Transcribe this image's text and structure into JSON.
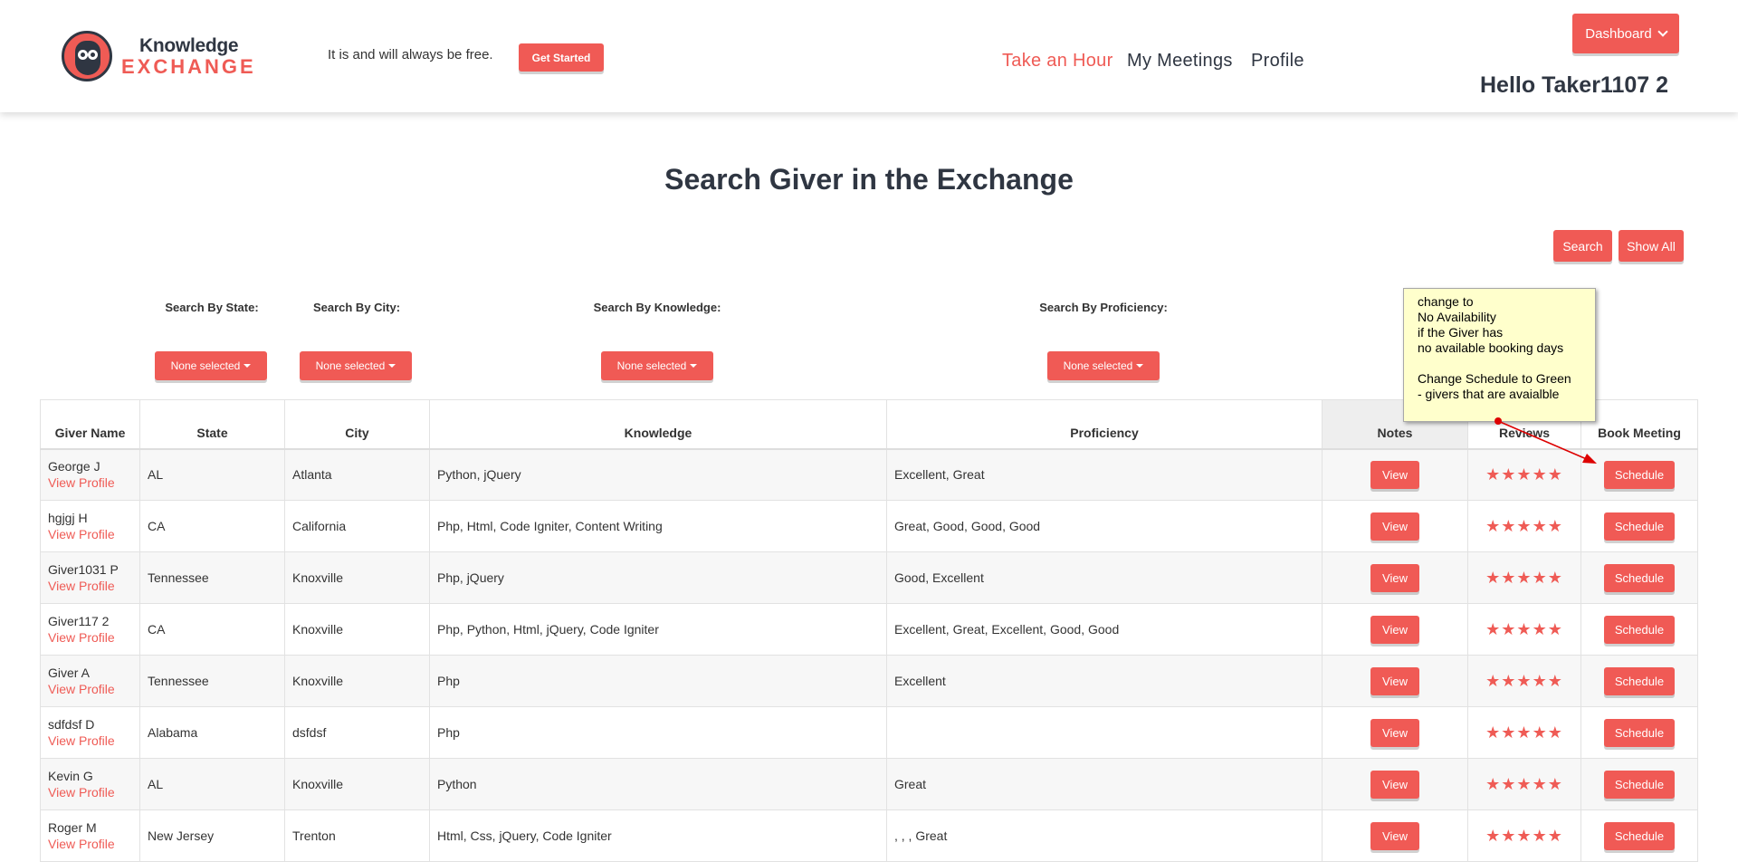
{
  "header": {
    "logo": {
      "line1": "Knowledge",
      "line2": "EXCHANGE"
    },
    "tagline": "It is and will always be free.",
    "get_started": "Get Started",
    "nav": [
      "Take an Hour",
      "My Meetings",
      "Profile"
    ],
    "dashboard": "Dashboard",
    "greeting": "Hello Taker1107 2"
  },
  "page_title": "Search Giver in the Exchange",
  "actions": {
    "search": "Search",
    "show_all": "Show All"
  },
  "filters": [
    {
      "label": "Search By State:",
      "value": "None selected"
    },
    {
      "label": "Search By City:",
      "value": "None selected"
    },
    {
      "label": "Search By Knowledge:",
      "value": "None selected"
    },
    {
      "label": "Search By Proficiency:",
      "value": "None selected"
    }
  ],
  "table": {
    "headers": [
      "Giver Name",
      "State",
      "City",
      "Knowledge",
      "Proficiency",
      "Notes",
      "Reviews",
      "Book Meeting"
    ],
    "view_profile": "View Profile",
    "view_label": "View",
    "schedule_label": "Schedule",
    "stars": "★★★★★",
    "rows": [
      {
        "name": "George J",
        "state": "AL",
        "city": "Atlanta",
        "knowledge": "Python, jQuery",
        "proficiency": "Excellent, Great"
      },
      {
        "name": "hgjgj H",
        "state": "CA",
        "city": "California",
        "knowledge": "Php, Html, Code Igniter, Content Writing",
        "proficiency": "Great, Good, Good, Good"
      },
      {
        "name": "Giver1031 P",
        "state": "Tennessee",
        "city": "Knoxville",
        "knowledge": "Php, jQuery",
        "proficiency": "Good, Excellent"
      },
      {
        "name": "Giver117 2",
        "state": "CA",
        "city": "Knoxville",
        "knowledge": "Php, Python, Html, jQuery, Code Igniter",
        "proficiency": "Excellent, Great, Excellent, Good, Good"
      },
      {
        "name": "Giver A",
        "state": "Tennessee",
        "city": "Knoxville",
        "knowledge": "Php",
        "proficiency": "Excellent"
      },
      {
        "name": "sdfdsf D",
        "state": "Alabama",
        "city": "dsfdsf",
        "knowledge": "Php",
        "proficiency": ""
      },
      {
        "name": "Kevin G",
        "state": "AL",
        "city": "Knoxville",
        "knowledge": "Python",
        "proficiency": "Great"
      },
      {
        "name": "Roger M",
        "state": "New Jersey",
        "city": "Trenton",
        "knowledge": "Html, Css, jQuery, Code Igniter",
        "proficiency": ", , , Great"
      }
    ]
  },
  "sticky_note": "change to\nNo Availability\nif the Giver has\nno available booking days\n\nChange Schedule to Green\n- givers that are avaialble",
  "colors": {
    "accent": "#ef5b55",
    "dark": "#2f3642",
    "note_bg": "#ffffcc"
  }
}
